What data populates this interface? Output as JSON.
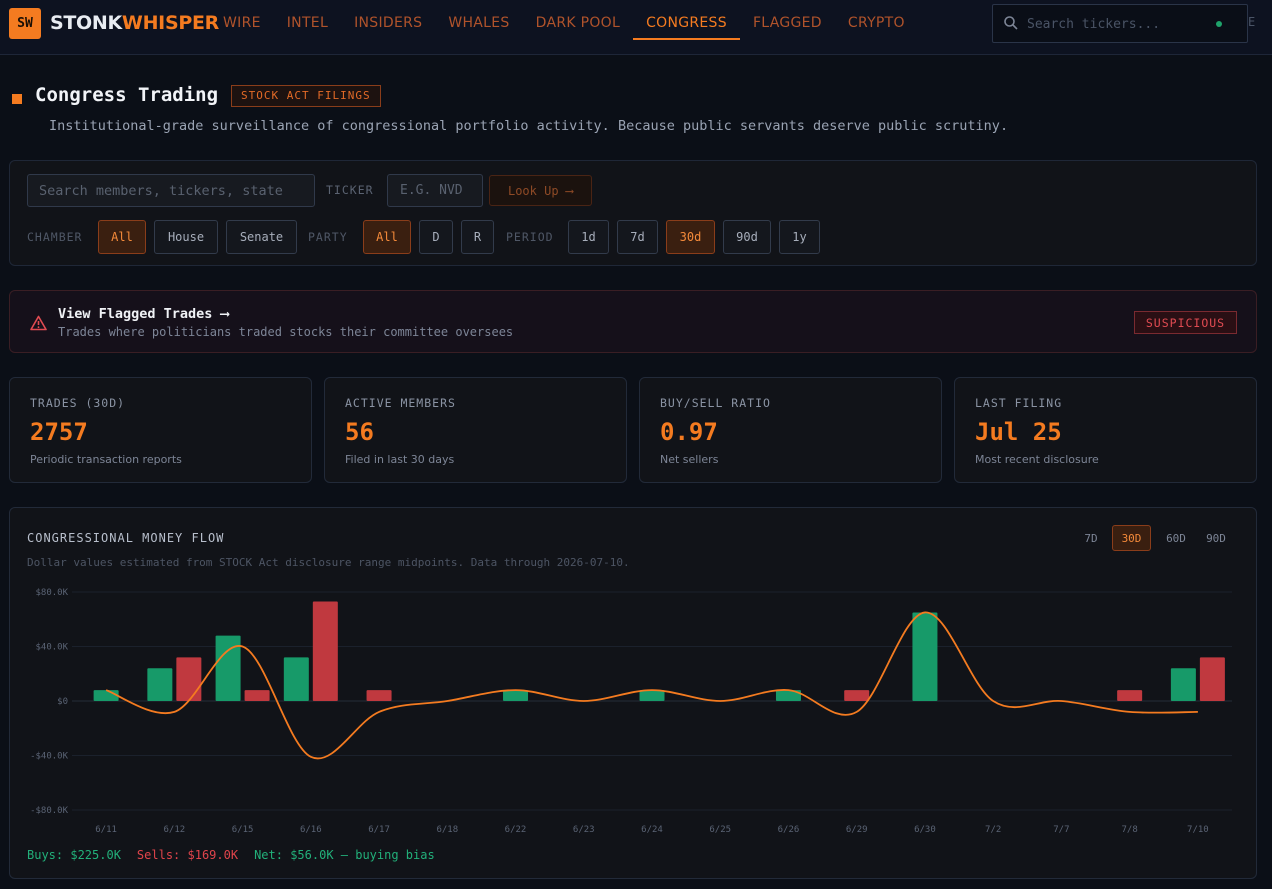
{
  "brand": {
    "logo_mark": "SW",
    "name_part1": "STONK",
    "name_part2": "WHISPER"
  },
  "nav": {
    "items": [
      "WIRE",
      "INTEL",
      "INSIDERS",
      "WHALES",
      "DARK POOL",
      "CONGRESS",
      "FLAGGED",
      "CRYPTO"
    ],
    "active": "CONGRESS"
  },
  "search": {
    "placeholder": "Search tickers...",
    "overflow_char": "E"
  },
  "header": {
    "title": "Congress Trading",
    "badge": "STOCK ACT FILINGS",
    "subtitle": "Institutional-grade surveillance of congressional portfolio activity. Because public servants deserve public scrutiny."
  },
  "filters": {
    "search_placeholder": "Search members, tickers, state",
    "ticker_label": "TICKER",
    "ticker_placeholder": "E.G. NVD",
    "lookup_label": "Look Up ⟶",
    "chamber_label": "CHAMBER",
    "chamber_options": [
      "All",
      "House",
      "Senate"
    ],
    "chamber_selected": "All",
    "party_label": "PARTY",
    "party_options": [
      "All",
      "D",
      "R"
    ],
    "party_selected": "All",
    "period_label": "PERIOD",
    "period_options": [
      "1d",
      "7d",
      "30d",
      "90d",
      "1y"
    ],
    "period_selected": "30d"
  },
  "flagged": {
    "title": "View Flagged Trades ⟶",
    "subtitle": "Trades where politicians traded stocks their committee oversees",
    "badge": "SUSPICIOUS"
  },
  "stats": [
    {
      "label": "TRADES (30D)",
      "value": "2757",
      "sub": "Periodic transaction reports"
    },
    {
      "label": "ACTIVE MEMBERS",
      "value": "56",
      "sub": "Filed in last 30 days"
    },
    {
      "label": "BUY/SELL RATIO",
      "value": "0.97",
      "sub": "Net sellers"
    },
    {
      "label": "LAST FILING",
      "value": "Jul 25",
      "sub": "Most recent disclosure"
    }
  ],
  "chart": {
    "title": "CONGRESSIONAL MONEY FLOW",
    "note": "Dollar values estimated from STOCK Act disclosure range midpoints. Data through 2026-07-10.",
    "ranges": [
      "7D",
      "30D",
      "60D",
      "90D"
    ],
    "range_selected": "30D",
    "summary": {
      "buys": "Buys: $225.0K",
      "sells": "Sells: $169.0K",
      "net": "Net: $56.0K — buying bias"
    }
  },
  "chart_data": {
    "type": "bar",
    "categories": [
      "6/11",
      "6/12",
      "6/15",
      "6/16",
      "6/17",
      "6/18",
      "6/22",
      "6/23",
      "6/24",
      "6/25",
      "6/26",
      "6/29",
      "6/30",
      "7/2",
      "7/7",
      "7/8",
      "7/10"
    ],
    "ylim": [
      -80000,
      80000
    ],
    "yticks": [
      80000,
      40000,
      0,
      -40000,
      -80000
    ],
    "ytick_labels": [
      "$80.0K",
      "$40.0K",
      "$0",
      "-$40.0K",
      "-$80.0K"
    ],
    "series": [
      {
        "type": "bar",
        "color": "#179a69",
        "values": [
          8000,
          24000,
          48000,
          32000,
          0,
          0,
          8000,
          0,
          8000,
          0,
          8000,
          0,
          65000,
          0,
          0,
          0,
          24000
        ]
      },
      {
        "type": "bar",
        "color": "#c0393f",
        "values": [
          0,
          32000,
          8000,
          73000,
          8000,
          0,
          0,
          0,
          0,
          0,
          0,
          8000,
          0,
          0,
          0,
          8000,
          32000
        ]
      },
      {
        "type": "line",
        "color": "#f47b20",
        "values": [
          8000,
          -8000,
          40000,
          -41000,
          -8000,
          0,
          8000,
          0,
          8000,
          0,
          8000,
          -8000,
          65000,
          0,
          0,
          -8000,
          -8000
        ]
      }
    ],
    "grid": true
  }
}
